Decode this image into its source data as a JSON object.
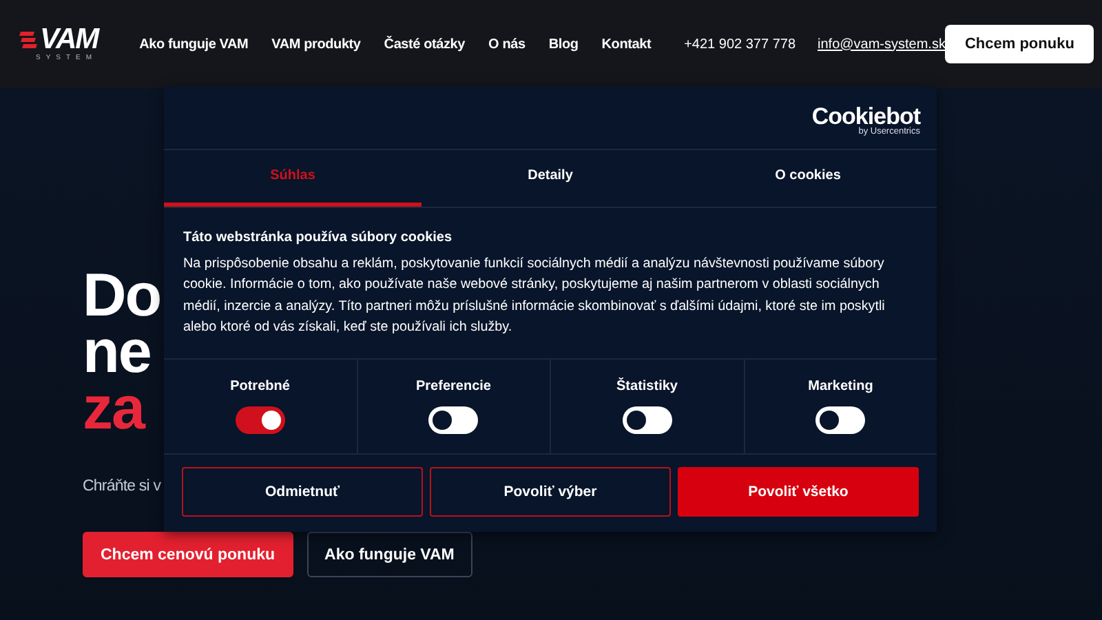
{
  "header": {
    "logo": {
      "word": "VAM",
      "sub": "SYSTEM"
    },
    "nav": [
      {
        "label": "Ako funguje VAM"
      },
      {
        "label": "VAM produkty"
      },
      {
        "label": "Časté otázky"
      },
      {
        "label": "O nás"
      },
      {
        "label": "Blog"
      },
      {
        "label": "Kontakt"
      }
    ],
    "phone": "+421 902 377 778",
    "email": "info@vam-system.sk",
    "cta": "Chcem ponuku"
  },
  "hero": {
    "title_lines": [
      {
        "text": "Do",
        "accent": false
      },
      {
        "text": "ne",
        "accent": false
      },
      {
        "text": "za",
        "accent": true
      }
    ],
    "subtitle": "Chráňte si v",
    "buttons": [
      {
        "label": "Chcem cenovú ponuku",
        "kind": "primary"
      },
      {
        "label": "Ako funguje VAM",
        "kind": "outline"
      }
    ]
  },
  "cookie_dialog": {
    "brand": "Cookiebot",
    "brand_sub": "by Usercentrics",
    "tabs": [
      {
        "label": "Súhlas",
        "selected": true
      },
      {
        "label": "Detaily",
        "selected": false
      },
      {
        "label": "O cookies",
        "selected": false
      }
    ],
    "heading": "Táto webstránka používa súbory cookies",
    "text": "Na prispôsobenie obsahu a reklám, poskytovanie funkcií sociálnych médií a analýzu návštevnosti používame súbory cookie. Informácie o tom, ako používate naše webové stránky, poskytujeme aj našim partnerom v oblasti sociálnych médií, inzercie a analýzy. Títo partneri môžu príslušné informácie skombinovať s ďalšími údajmi, ktoré ste im poskytli alebo ktoré od vás získali, keď ste používali ich služby.",
    "categories": [
      {
        "label": "Potrebné",
        "on": true
      },
      {
        "label": "Preferencie",
        "on": false
      },
      {
        "label": "Štatistiky",
        "on": false
      },
      {
        "label": "Marketing",
        "on": false
      }
    ],
    "buttons": [
      {
        "label": "Odmietnuť",
        "kind": "outline"
      },
      {
        "label": "Povoliť výber",
        "kind": "outline"
      },
      {
        "label": "Povoliť všetko",
        "kind": "primary"
      }
    ]
  }
}
